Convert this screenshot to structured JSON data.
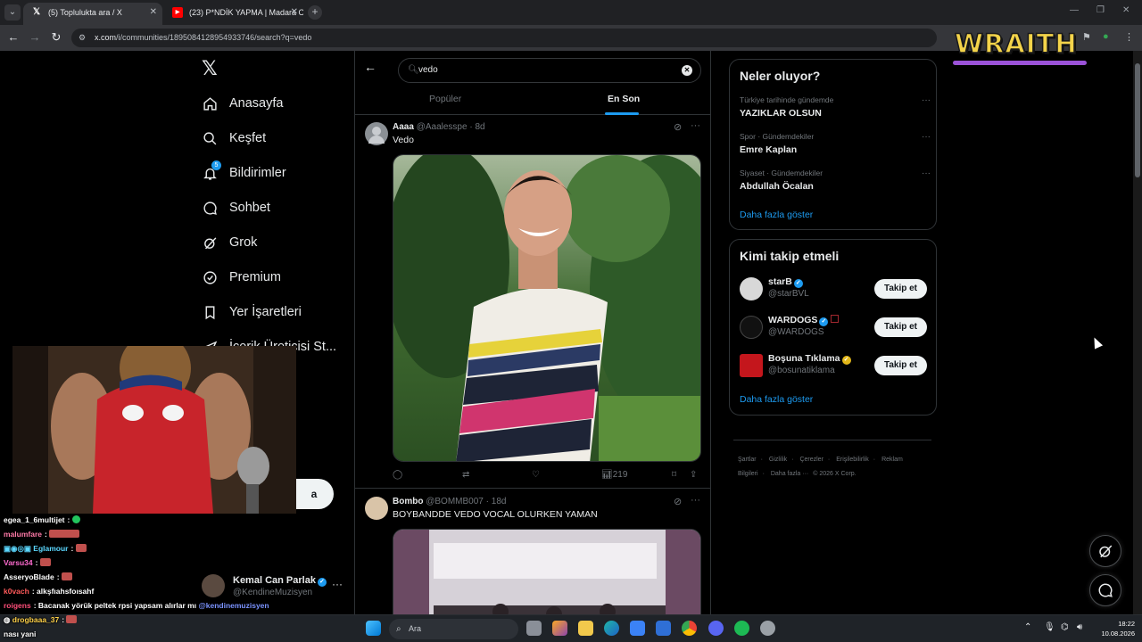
{
  "browser": {
    "tabs": [
      {
        "title": "(5) Toplulukta ara / X",
        "icon": "x-icon",
        "active": true
      },
      {
        "title": "(23) P*NDİK YAPMA | Madara O",
        "icon": "youtube-icon",
        "active": false
      }
    ],
    "url_host": "x.com",
    "url_path": "/i/communities/1895084128954933746/search?q=vedo"
  },
  "overlay_logo": "WRAITH",
  "nav": {
    "items": [
      {
        "label": "Anasayfa",
        "icon": "home-icon"
      },
      {
        "label": "Keşfet",
        "icon": "search-icon"
      },
      {
        "label": "Bildirimler",
        "icon": "bell-icon",
        "badge": "5"
      },
      {
        "label": "Sohbet",
        "icon": "chat-icon"
      },
      {
        "label": "Grok",
        "icon": "grok-icon"
      },
      {
        "label": "Premium",
        "icon": "premium-icon"
      },
      {
        "label": "Yer İşaretleri",
        "icon": "bookmark-icon"
      },
      {
        "label": "İçerik Üreticisi St...",
        "icon": "studio-icon"
      }
    ],
    "post_button_fragment": "a",
    "profile": {
      "name": "Kemal Can Parlak",
      "handle": "@KendineMuzisyen"
    }
  },
  "search": {
    "value": "vedo",
    "tabs": [
      "Popüler",
      "En Son"
    ],
    "active_tab": "En Son"
  },
  "posts": [
    {
      "name": "Aaaa",
      "handle": "@Aaalesspe",
      "time": "8d",
      "text": "Vedo",
      "views": "219"
    },
    {
      "name": "Bombo",
      "handle": "@BOMMB007",
      "time": "18d",
      "text": "BOYBANDDE VEDO VOCAL OLURKEN YAMAN"
    }
  ],
  "trends": {
    "title": "Neler oluyor?",
    "items": [
      {
        "category": "Türkiye tarihinde gündemde",
        "title": "YAZIKLAR OLSUN"
      },
      {
        "category": "Spor · Gündemdekiler",
        "title": "Emre Kaplan"
      },
      {
        "category": "Siyaset · Gündemdekiler",
        "title": "Abdullah Öcalan"
      }
    ],
    "show_more": "Daha fazla göster"
  },
  "who_to_follow": {
    "title": "Kimi takip etmeli",
    "items": [
      {
        "name": "starB",
        "handle": "@starBVL",
        "badge": "blue"
      },
      {
        "name": "WARDOGS",
        "handle": "@WARDOGS",
        "badge": "blue"
      },
      {
        "name": "Boşuna Tıklama",
        "handle": "@bosunatiklama",
        "badge": "gold"
      }
    ],
    "follow_label": "Takip et",
    "show_more": "Daha fazla göster"
  },
  "footer": {
    "links": [
      "Şartlar",
      "·",
      "Gizlilik",
      "·",
      "Çerezler",
      "·",
      "Erişilebilirlik",
      "·",
      "Reklam Bilgileri",
      "·",
      "Daha fazla ···",
      "© 2026 X Corp."
    ]
  },
  "chat": [
    {
      "user": "egea_1_6multijet",
      "color": "#ffffff",
      "msg": ""
    },
    {
      "user": "malumfare",
      "color": "#ff7aa8",
      "msg": ""
    },
    {
      "user": "Eglamour",
      "color": "#5bd7ff",
      "msg": ""
    },
    {
      "user": "Varsu34",
      "color": "#ff6bd0",
      "msg": ""
    },
    {
      "user": "AsseryoBlade",
      "color": "#ffffff",
      "msg": ""
    },
    {
      "user": "k0vach",
      "color": "#ff5a5a",
      "msg": "alkşfıahsfoısahf"
    },
    {
      "user": "roigens",
      "color": "#ff4f7a",
      "msg": "Bacanak yörük peltek rpsi yapsam alırlar mı",
      "mention": "@kendinemuzisyen"
    },
    {
      "user": "drogbaaa_37",
      "color": "#ffd24a",
      "msg": ""
    },
    {
      "user": "",
      "color": "#ffffff",
      "msg": "nası yani"
    }
  ],
  "taskbar": {
    "search_placeholder": "Ara",
    "time": "18:22",
    "date": "10.08.2026"
  },
  "colors": {
    "accent": "#1d9bf0",
    "background": "#000000",
    "border": "#2f3336",
    "muted": "#71767b"
  }
}
